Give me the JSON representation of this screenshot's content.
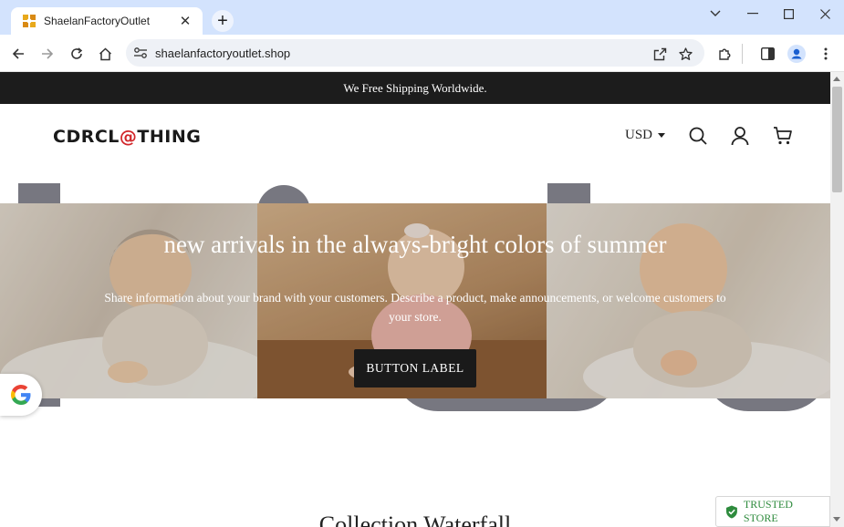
{
  "browser": {
    "tab_title": "ShaelanFactoryOutlet",
    "url": "shaelanfactoryoutlet.shop"
  },
  "announcement": "We Free Shipping Worldwide.",
  "header": {
    "logo_prefix": "CDRCL",
    "logo_swirl": "@",
    "logo_suffix": "THING",
    "currency": "USD"
  },
  "hero": {
    "title": "new arrivals in the always-bright colors of summer",
    "subtitle": "Share information about your brand with your customers. Describe a product, make announcements, or welcome customers to your store.",
    "button_label": "BUTTON LABEL"
  },
  "section_title": "Collection Waterfall",
  "trusted_badge": "TRUSTED STORE",
  "colors": {
    "tab_strip": "#d3e3fd",
    "announcement_bg": "#1c1c1c",
    "logo_accent": "#d1262a",
    "trusted_green": "#2e8b3d"
  }
}
